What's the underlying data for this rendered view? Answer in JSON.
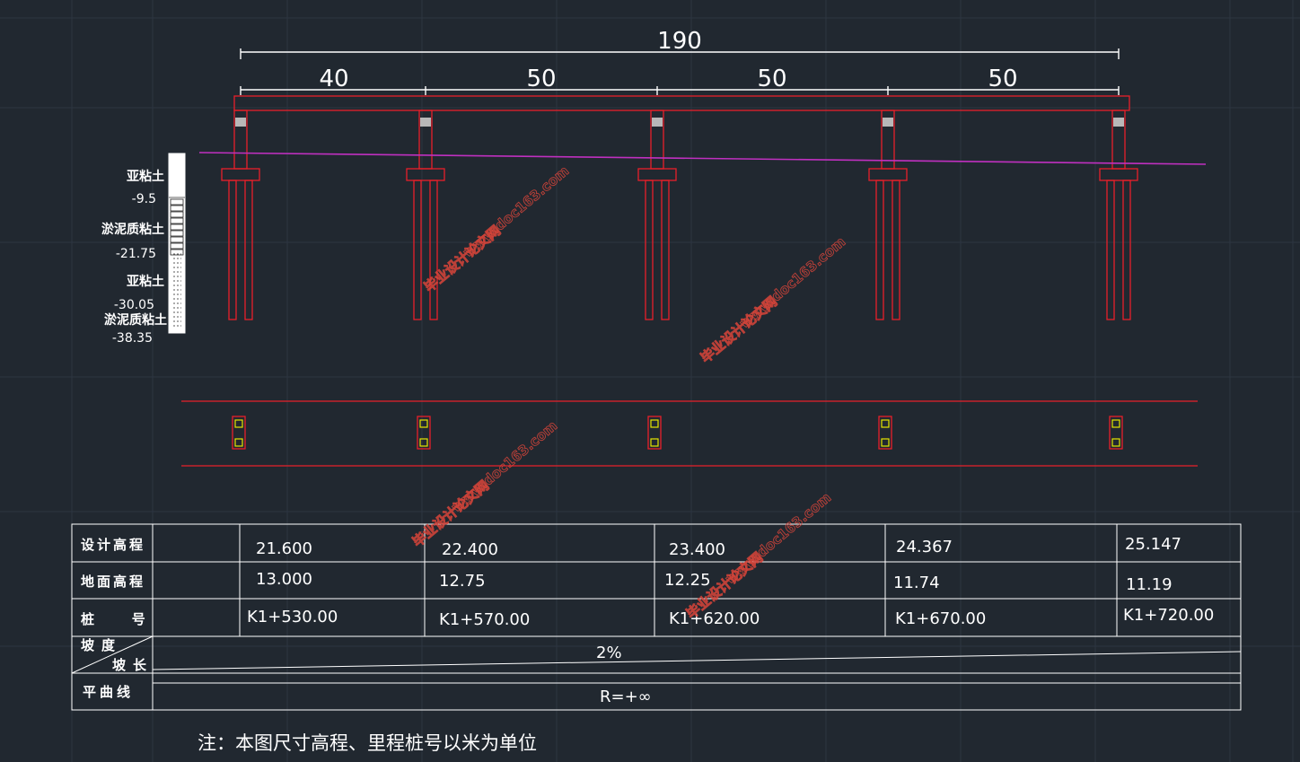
{
  "dimensions": {
    "total": "190",
    "spans": [
      "40",
      "50",
      "50",
      "50"
    ]
  },
  "soil_profile": {
    "layers": [
      {
        "name": "亚粘土",
        "bottom": "-9.5"
      },
      {
        "name": "淤泥质粘土",
        "bottom": "-21.75"
      },
      {
        "name": "亚粘土",
        "bottom": "-30.05"
      },
      {
        "name": "淤泥质粘土",
        "bottom": "-38.35"
      }
    ]
  },
  "table": {
    "rows": [
      {
        "label": "设计高程",
        "values": [
          "21.600",
          "22.400",
          "23.400",
          "24.367",
          "25.147"
        ]
      },
      {
        "label": "地面高程",
        "values": [
          "13.000",
          "12.75",
          "12.25",
          "11.74",
          "11.19"
        ]
      },
      {
        "label": "桩        号",
        "values": [
          "K1+530.00",
          "K1+570.00",
          "K1+620.00",
          "K1+670.00",
          "K1+720.00"
        ]
      }
    ],
    "slope_label": "坡度",
    "slope_length_label": "坡长",
    "slope_value": "2%",
    "curve_label": "平曲线",
    "curve_value": "R=+∞"
  },
  "note": "注：本图尺寸高程、里程桩号以米为单位",
  "watermark": {
    "line1": "毕业设计论文网",
    "line2": "www.doc163.com"
  },
  "colors": {
    "background": "#212830",
    "grid": "#2c3540",
    "structure": "#e8202a",
    "ground_line": "#c030c0",
    "dimension": "#ffffff",
    "pile_cap_fill": "#b8b8b8",
    "plan_marker": "#e6e600"
  }
}
